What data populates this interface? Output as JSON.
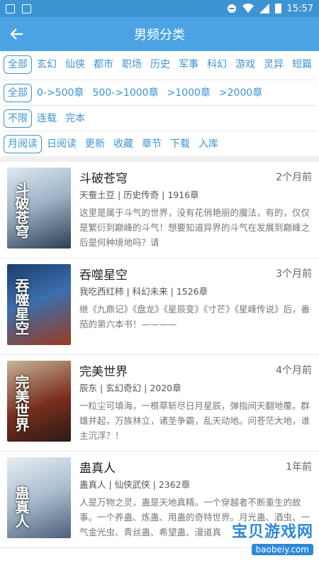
{
  "status": {
    "time": "15:57"
  },
  "header": {
    "title": "男频分类"
  },
  "filters": {
    "categories": [
      "全部",
      "玄幻",
      "仙侠",
      "都市",
      "职场",
      "历史",
      "军事",
      "科幻",
      "游戏",
      "灵异",
      "短篇"
    ],
    "word_counts": [
      "全部",
      "0->500章",
      "500->1000章",
      ">1000章",
      ">2000章"
    ],
    "status": [
      "不限",
      "连载",
      "完本"
    ],
    "sort": [
      "月阅读",
      "日阅读",
      "更新",
      "收藏",
      "章节",
      "下载",
      "入库"
    ]
  },
  "books": [
    {
      "name": "斗破苍穹",
      "time": "2个月前",
      "meta": "天蚕土豆 | 历史传奇 | 1916章",
      "desc": "这里是属于斗气的世界，没有花俏艳丽的魔法，有的，仅仅是繁衍到巅峰的斗气！想要知道异界的斗气在发展到巅峰之后是何种境地吗？请",
      "cover_text": "斗破苍穹"
    },
    {
      "name": "吞噬星空",
      "time": "3个月前",
      "meta": "我吃西红柿 | 科幻未来 | 1526章",
      "desc": "继《九鼎记》《盘龙》《星辰变》《寸芒》《星峰传说》后，番茄的第六本书！————",
      "cover_text": "吞噬星空"
    },
    {
      "name": "完美世界",
      "time": "4个月前",
      "meta": "辰东 | 玄幻奇幻 | 2020章",
      "desc": "一粒尘可填海，一根草斩尽日月星辰，弹指间天翻地覆。群雄并起，万族林立，诸圣争霸，乱天动地。问苍茫大地，谁主沉浮？！",
      "cover_text": "完美世界"
    },
    {
      "name": "蛊真人",
      "time": "1年前",
      "meta": "蛊真人 | 仙侠武侠 | 2362章",
      "desc": "人是万物之灵，蛊是天地真精。一个穿越者不断重生的故事。一个养蛊、炼蛊、用蛊的奇特世界。月光蛊、酒虫、一气金光虫、青丝蛊、希望蛊、漫道真",
      "cover_text": "蛊真人"
    }
  ],
  "watermark": {
    "logo": "宝贝游戏网",
    "url": "baobeiy.com"
  }
}
